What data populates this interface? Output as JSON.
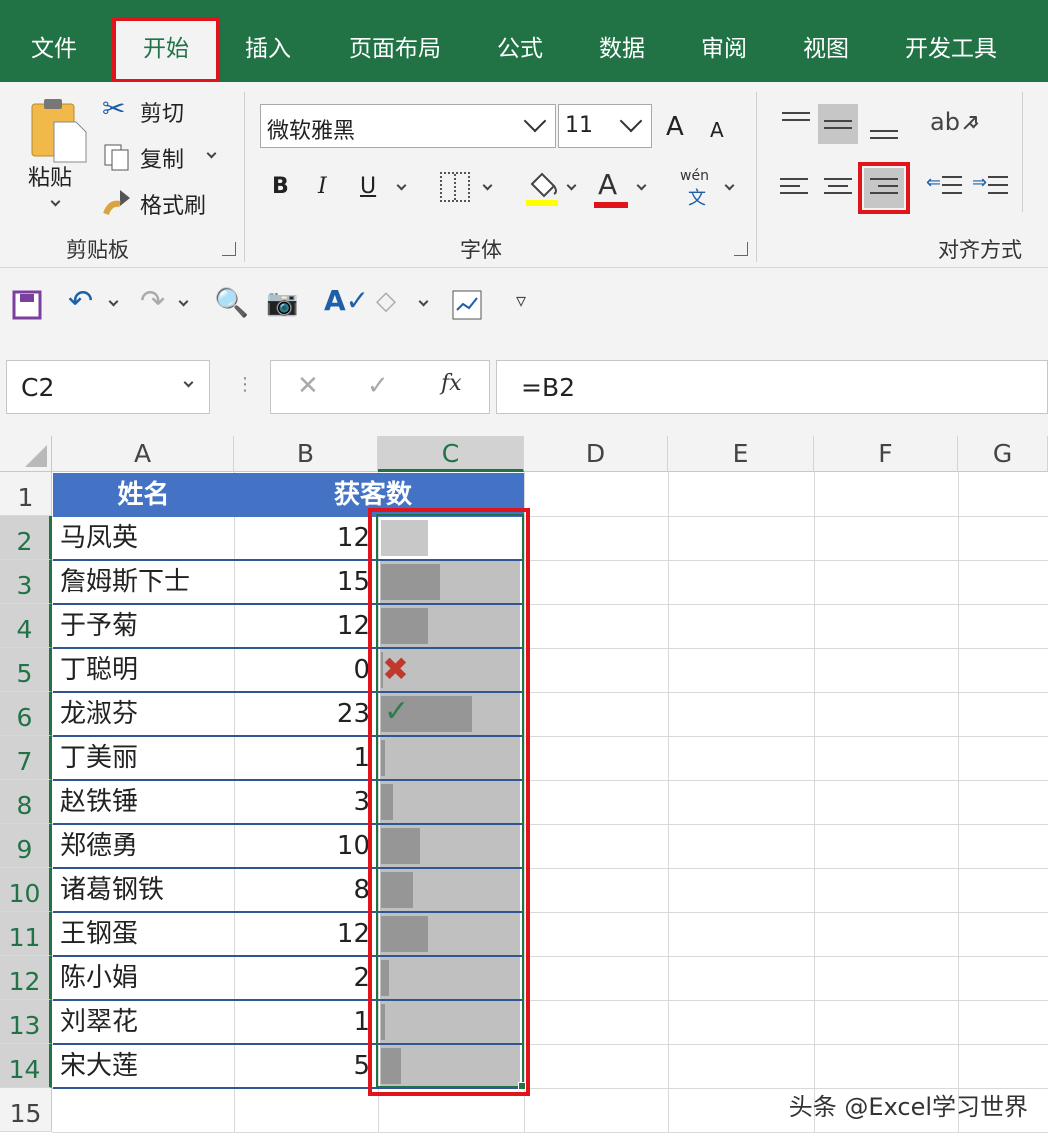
{
  "ribbon_tabs": [
    "文件",
    "开始",
    "插入",
    "页面布局",
    "公式",
    "数据",
    "审阅",
    "视图",
    "开发工具"
  ],
  "clipboard": {
    "paste": "粘贴",
    "cut": "剪切",
    "copy": "复制",
    "format_painter": "格式刷",
    "group_label": "剪贴板"
  },
  "font": {
    "name": "微软雅黑",
    "size": "11",
    "bold": "B",
    "italic": "I",
    "underline": "U",
    "font_color_glyph": "A",
    "grow": "A",
    "shrink": "A",
    "phonetic_top": "wén",
    "phonetic_bottom": "文",
    "group_label": "字体"
  },
  "alignment": {
    "group_label": "对齐方式"
  },
  "formula_bar": {
    "name_box": "C2",
    "formula": "=B2",
    "fx_label": "fx"
  },
  "columns": [
    "A",
    "B",
    "C",
    "D",
    "E",
    "F",
    "G"
  ],
  "rows": [
    "1",
    "2",
    "3",
    "4",
    "5",
    "6",
    "7",
    "8",
    "9",
    "10",
    "11",
    "12",
    "13",
    "14",
    "15"
  ],
  "table": {
    "headers": [
      "姓名",
      "获客数"
    ],
    "data": [
      {
        "name": "马凤英",
        "value": 12
      },
      {
        "name": "詹姆斯下士",
        "value": 15
      },
      {
        "name": "于予菊",
        "value": 12
      },
      {
        "name": "丁聪明",
        "value": 0
      },
      {
        "name": "龙淑芬",
        "value": 23
      },
      {
        "name": "丁美丽",
        "value": 1
      },
      {
        "name": "赵铁锤",
        "value": 3
      },
      {
        "name": "郑德勇",
        "value": 10
      },
      {
        "name": "诸葛钢铁",
        "value": 8
      },
      {
        "name": "王钢蛋",
        "value": 12
      },
      {
        "name": "陈小娟",
        "value": 2
      },
      {
        "name": "刘翠花",
        "value": 1
      },
      {
        "name": "宋大莲",
        "value": 5
      }
    ],
    "databar_max": 35,
    "icons": {
      "row_4": "cross-icon",
      "row_5": "check-icon"
    }
  },
  "colors": {
    "excel_green": "#217346",
    "header_blue": "#4472c4",
    "highlight_red": "#e0141b",
    "bar_gray": "#969696",
    "bar_bg": "#c0c0c0"
  },
  "watermark": "头条 @Excel学习世界"
}
